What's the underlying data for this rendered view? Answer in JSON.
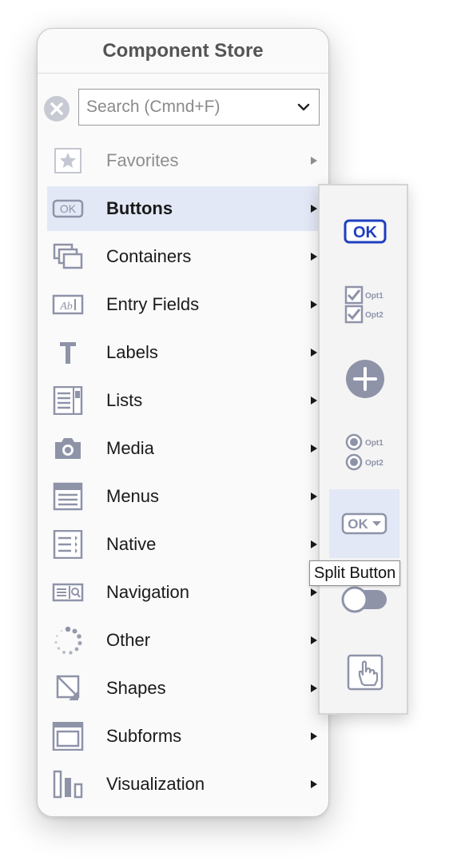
{
  "window": {
    "title": "Component Store"
  },
  "search": {
    "placeholder": "Search (Cmnd+F)",
    "value": ""
  },
  "categories": [
    {
      "label": "Favorites",
      "icon": "star-icon",
      "state": "disabled"
    },
    {
      "label": "Buttons",
      "icon": "ok-button-icon",
      "state": "selected"
    },
    {
      "label": "Containers",
      "icon": "stacked-windows-icon"
    },
    {
      "label": "Entry Fields",
      "icon": "text-field-icon"
    },
    {
      "label": "Labels",
      "icon": "letter-t-icon"
    },
    {
      "label": "Lists",
      "icon": "list-icon"
    },
    {
      "label": "Media",
      "icon": "camera-icon"
    },
    {
      "label": "Menus",
      "icon": "menu-icon"
    },
    {
      "label": "Native",
      "icon": "native-window-icon"
    },
    {
      "label": "Navigation",
      "icon": "search-bar-icon"
    },
    {
      "label": "Other",
      "icon": "spinner-icon"
    },
    {
      "label": "Shapes",
      "icon": "shapes-icon"
    },
    {
      "label": "Subforms",
      "icon": "subform-icon"
    },
    {
      "label": "Visualization",
      "icon": "bar-chart-icon"
    }
  ],
  "submenu": {
    "items": [
      {
        "name": "Push Button",
        "icon": "ok-button-icon",
        "text": "OK"
      },
      {
        "name": "Check Boxes",
        "icon": "checkbox-group-icon",
        "opt1": "Opt1",
        "opt2": "Opt2"
      },
      {
        "name": "Add Button",
        "icon": "plus-circle-icon"
      },
      {
        "name": "Radio Buttons",
        "icon": "radio-group-icon",
        "opt1": "Opt1",
        "opt2": "Opt2"
      },
      {
        "name": "Split Button",
        "icon": "split-button-icon",
        "text": "OK"
      },
      {
        "name": "Toggle Switch",
        "icon": "toggle-switch-icon"
      },
      {
        "name": "Touch Button",
        "icon": "hand-pointer-icon"
      }
    ]
  },
  "tooltip": {
    "text": "Split Button"
  },
  "colors": {
    "accent": "#1f3fbf",
    "icon": "#8e93a8",
    "selected": "#e3e8f6"
  }
}
